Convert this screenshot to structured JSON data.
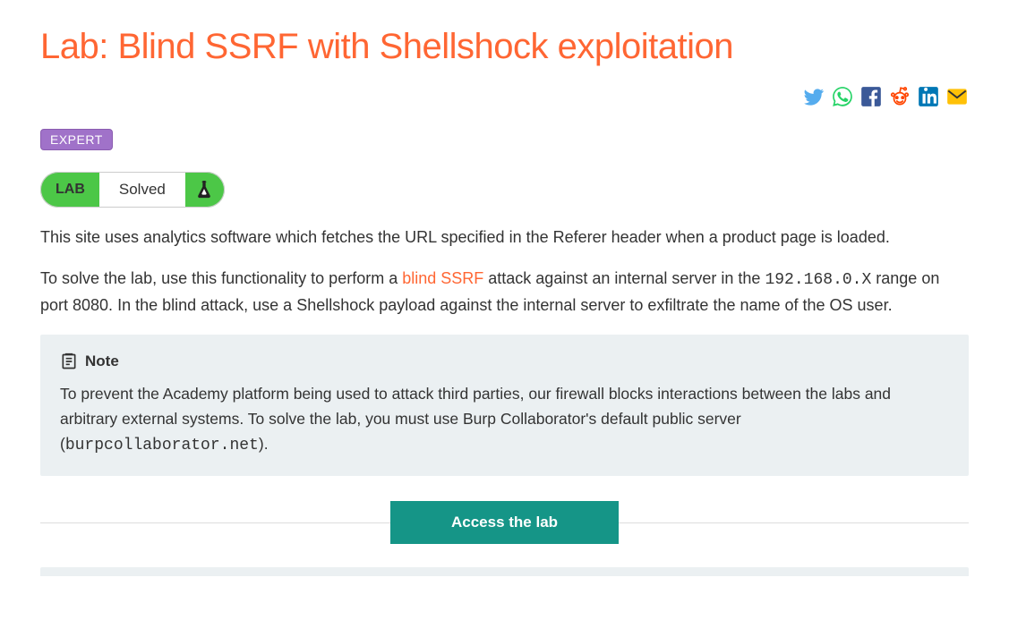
{
  "title": "Lab: Blind SSRF with Shellshock exploitation",
  "difficulty": "EXPERT",
  "lab_status": {
    "label": "LAB",
    "state": "Solved"
  },
  "paragraphs": {
    "p1": "This site uses analytics software which fetches the URL specified in the Referer header when a product page is loaded.",
    "p2_pre": "To solve the lab, use this functionality to perform a ",
    "p2_link": "blind SSRF",
    "p2_mid": " attack against an internal server in the ",
    "p2_code": "192.168.0.X",
    "p2_post": " range on port 8080. In the blind attack, use a Shellshock payload against the internal server to exfiltrate the name of the OS user."
  },
  "note": {
    "heading": "Note",
    "body_pre": "To prevent the Academy platform being used to attack third parties, our firewall blocks interactions between the labs and arbitrary external systems. To solve the lab, you must use Burp Collaborator's default public server (",
    "body_code": "burpcollaborator.net",
    "body_post": ")."
  },
  "access_button": "Access the lab",
  "share": {
    "twitter": "twitter-icon",
    "whatsapp": "whatsapp-icon",
    "facebook": "facebook-icon",
    "reddit": "reddit-icon",
    "linkedin": "linkedin-icon",
    "email": "email-icon"
  }
}
